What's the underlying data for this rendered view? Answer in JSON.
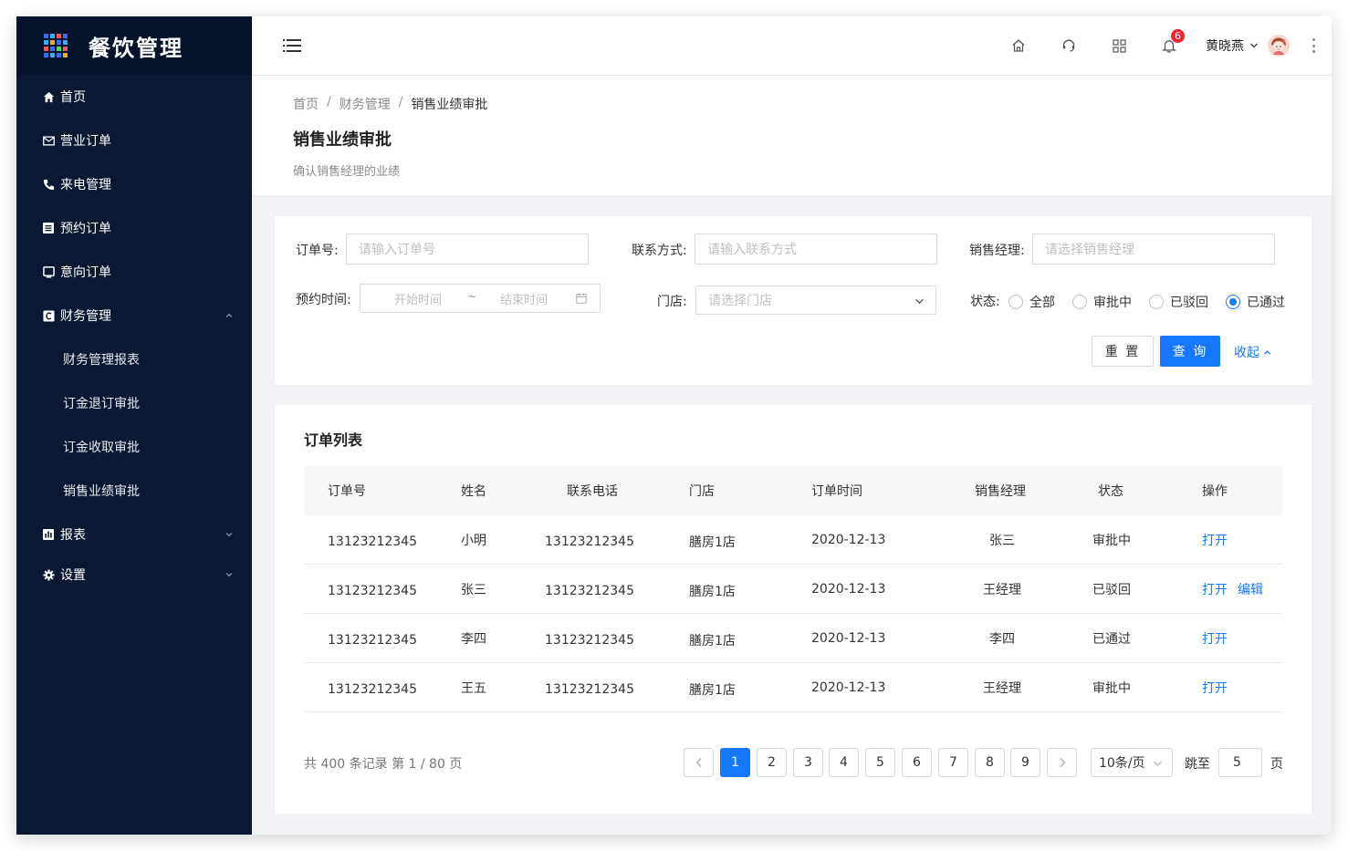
{
  "app": {
    "title": "餐饮管理"
  },
  "sidebar": {
    "items": [
      {
        "label": "首页",
        "icon": "home-icon"
      },
      {
        "label": "营业订单",
        "icon": "mail-icon"
      },
      {
        "label": "来电管理",
        "icon": "phone-icon"
      },
      {
        "label": "预约订单",
        "icon": "list-icon"
      },
      {
        "label": "意向订单",
        "icon": "monitor-icon"
      },
      {
        "label": "财务管理",
        "icon": "finance-icon",
        "expanded": true,
        "children": [
          {
            "label": "财务管理报表"
          },
          {
            "label": "订金退订审批"
          },
          {
            "label": "订金收取审批"
          },
          {
            "label": "销售业绩审批"
          }
        ]
      },
      {
        "label": "报表",
        "icon": "chart-icon"
      },
      {
        "label": "设置",
        "icon": "gear-icon"
      }
    ]
  },
  "header": {
    "notification_count": "6",
    "user_name": "黄晓燕"
  },
  "breadcrumb": {
    "items": [
      "首页",
      "财务管理",
      "销售业绩审批"
    ]
  },
  "page": {
    "title": "销售业绩审批",
    "description": "确认销售经理的业绩"
  },
  "filters": {
    "order_no": {
      "label": "订单号:",
      "placeholder": "请输入订单号"
    },
    "contact": {
      "label": "联系方式:",
      "placeholder": "请输入联系方式"
    },
    "manager": {
      "label": "销售经理:",
      "placeholder": "请选择销售经理"
    },
    "booking_time": {
      "label": "预约时间:",
      "start_placeholder": "开始时间",
      "separator": "~",
      "end_placeholder": "结束时间"
    },
    "store": {
      "label": "门店:",
      "placeholder": "请选择门店"
    },
    "status": {
      "label": "状态:",
      "options": [
        "全部",
        "审批中",
        "已驳回",
        "已通过"
      ],
      "selected": "已通过"
    },
    "reset_label": "重 置",
    "search_label": "查 询",
    "collapse_label": "收起"
  },
  "table": {
    "title": "订单列表",
    "columns": [
      "订单号",
      "姓名",
      "联系电话",
      "门店",
      "订单时间",
      "销售经理",
      "状态",
      "操作"
    ],
    "rows": [
      {
        "order_no": "13123212345",
        "name": "小明",
        "phone": "13123212345",
        "store": "膳房1店",
        "time": "2020-12-13",
        "manager": "张三",
        "status": "审批中",
        "actions": [
          "打开"
        ]
      },
      {
        "order_no": "13123212345",
        "name": "张三",
        "phone": "13123212345",
        "store": "膳房1店",
        "time": "2020-12-13",
        "manager": "王经理",
        "status": "已驳回",
        "actions": [
          "打开",
          "编辑"
        ]
      },
      {
        "order_no": "13123212345",
        "name": "李四",
        "phone": "13123212345",
        "store": "膳房1店",
        "time": "2020-12-13",
        "manager": "李四",
        "status": "已通过",
        "actions": [
          "打开"
        ]
      },
      {
        "order_no": "13123212345",
        "name": "王五",
        "phone": "13123212345",
        "store": "膳房1店",
        "time": "2020-12-13",
        "manager": "王经理",
        "status": "审批中",
        "actions": [
          "打开"
        ]
      }
    ]
  },
  "pagination": {
    "summary": "共 400 条记录 第 1 / 80 页",
    "pages": [
      "1",
      "2",
      "3",
      "4",
      "5",
      "6",
      "7",
      "8",
      "9"
    ],
    "current": "1",
    "page_size": "10条/页",
    "jump_label": "跳至",
    "jump_value": "5",
    "jump_suffix": "页"
  },
  "colors": {
    "sidebar_bg": "#0a1831",
    "primary": "#1677ff",
    "badge": "#f5222d"
  }
}
